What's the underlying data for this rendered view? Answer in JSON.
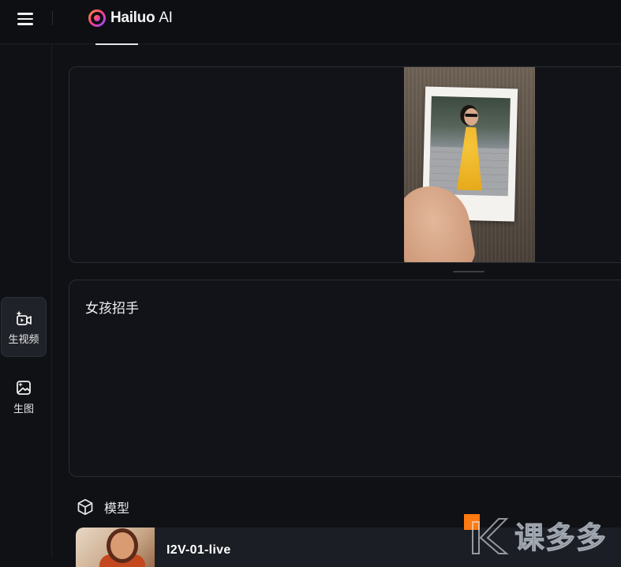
{
  "header": {
    "brand_name": "Hailuo",
    "brand_suffix": "AI",
    "brand_color": "#f4f4f6",
    "menu_icon": "hamburger-menu-icon"
  },
  "sidebar": {
    "items": [
      {
        "label": "生视频",
        "icon": "video-sparkle-icon",
        "active": true
      },
      {
        "label": "生图",
        "icon": "image-sparkle-icon",
        "active": false
      }
    ]
  },
  "upload": {
    "image_subject": "uploaded-polaroid-photo"
  },
  "prompt": {
    "text": "女孩招手"
  },
  "model": {
    "section_title": "模型",
    "section_icon": "cube-icon",
    "selected_name": "I2V-01-live"
  },
  "watermark": {
    "text": "课多多"
  },
  "colors": {
    "background": "#0f1115",
    "panel": "#111318",
    "panel_border": "#2a2d33",
    "text": "#e8e8ea"
  }
}
